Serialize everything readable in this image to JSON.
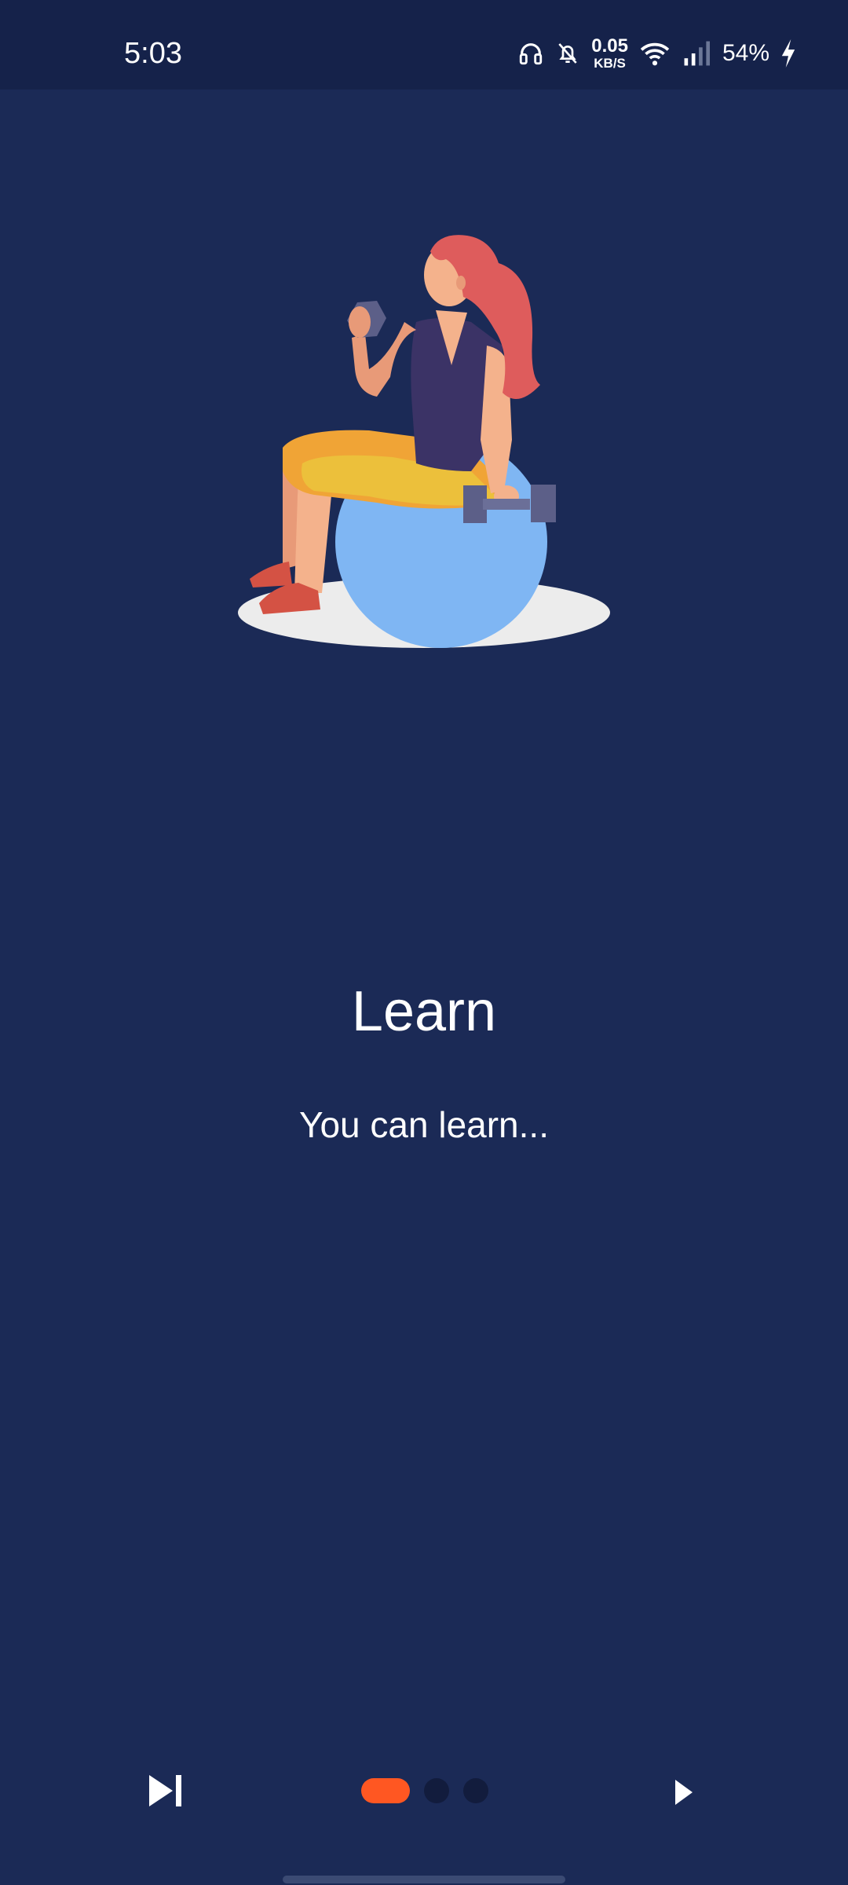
{
  "status_bar": {
    "time": "5:03",
    "net_speed_value": "0.05",
    "net_speed_unit": "KB/S",
    "battery": "54%",
    "icons": [
      "headphones-icon",
      "bell-off-icon",
      "wifi-icon",
      "cell-signal-icon",
      "charging-bolt-icon"
    ]
  },
  "illustration": {
    "subject": "woman-on-exercise-ball-with-dumbbells-illustration"
  },
  "onboarding": {
    "title": "Learn",
    "subtitle": "You can learn...",
    "page_count": 3,
    "current_page": 1
  },
  "controls": {
    "skip_icon": "skip-next-icon",
    "next_icon": "play-arrow-icon"
  },
  "colors": {
    "background": "#1b2a56",
    "status_bar": "#15224a",
    "accent": "#ff5722",
    "inactive_dot": "#121c3d",
    "text": "#ffffff"
  }
}
